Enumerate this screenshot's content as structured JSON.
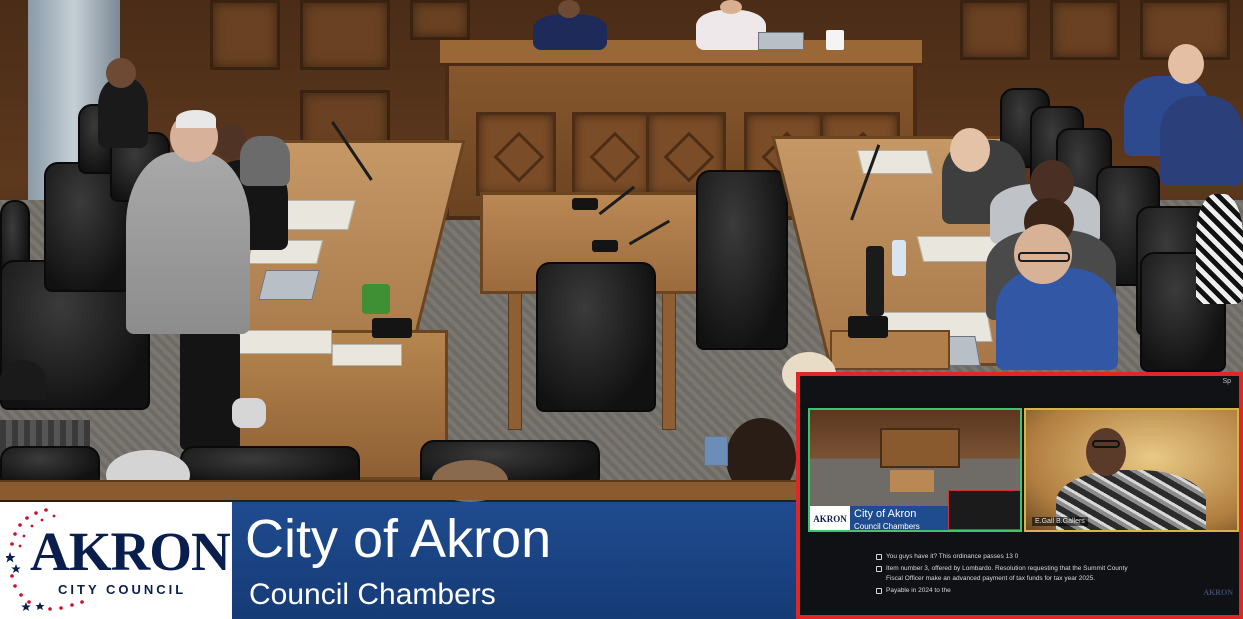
{
  "stream": {
    "logo": {
      "word": "AKRON",
      "subtitle": "CITY COUNCIL"
    },
    "lower_third": {
      "title": "City of Akron",
      "subtitle": "Council Chambers"
    }
  },
  "pip": {
    "corner_label": "Sp",
    "tile_chamber": {
      "logo": "AKRON",
      "title": "City of Akron",
      "subtitle": "Council Chambers"
    },
    "tile_participant": {
      "name_tag": "E.Gall B.Gallers"
    },
    "captions": [
      "You guys have it? This ordinance passes 13 0",
      "Item number 3, offered by Lombardo. Resolution requesting that the Summit County",
      "Fiscal Officer make an advanced payment of tax funds for tax year 2025.",
      "Payable in 2024 to the"
    ],
    "watermark": "AKRON"
  },
  "colors": {
    "banner_blue": "#1f4b8f",
    "logo_navy": "#0a1e4d",
    "logo_star_red": "#c8102e",
    "pip_border": "#e02626",
    "tile_active_border": "#3ec46d",
    "tile_speaker_border": "#d6b44a"
  }
}
